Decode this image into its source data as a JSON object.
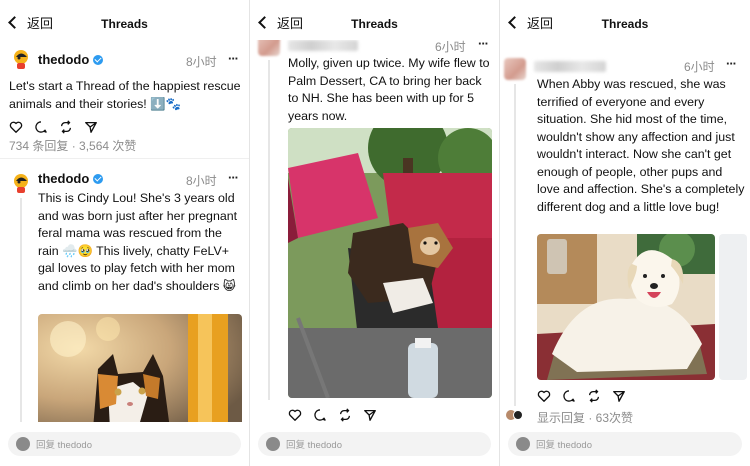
{
  "panels": [
    {
      "nav": {
        "back_label": "返回",
        "title": "Threads"
      },
      "posts": [
        {
          "username": "thedodo",
          "time": "8小时",
          "more": "···",
          "text": "Let's start a Thread of the happiest rescue animals and their stories! ⬇️🐾",
          "stats": "734 条回复 · 3,564 次赞"
        },
        {
          "username": "thedodo",
          "time": "8小时",
          "more": "···",
          "text": "This is Cindy Lou! She's 3 years old and was born just after her pregnant feral mama was rescued from the rain 🌧️🥹 This lively, chatty FeLV+ gal loves to play fetch with her mom and climb on her dad's shoulders 😸"
        }
      ],
      "reply_placeholder": "回复 thedodo"
    },
    {
      "nav": {
        "back_label": "返回",
        "title": "Threads"
      },
      "post": {
        "time": "6小时",
        "more": "···",
        "text": "Molly, given up twice. My wife flew to Palm Dessert, CA to bring her back to NH. She has been with up for 5 years now."
      },
      "reply_placeholder": "回复 thedodo"
    },
    {
      "nav": {
        "back_label": "返回",
        "title": "Threads"
      },
      "post": {
        "time": "6小时",
        "more": "···",
        "text": "When Abby was rescued, she was terrified of everyone and every situation. She hid most of the time, wouldn't show any affection and just wouldn't interact. Now she can't get enough of people, other pups and love and affection. She's a completely different dog and a little love bug!",
        "stats": "显示回复 · 63次赞"
      },
      "reply_placeholder": "回复 thedodo"
    }
  ],
  "colors": {
    "verified": "#2d9bf0",
    "muted": "#8c8c8c"
  }
}
